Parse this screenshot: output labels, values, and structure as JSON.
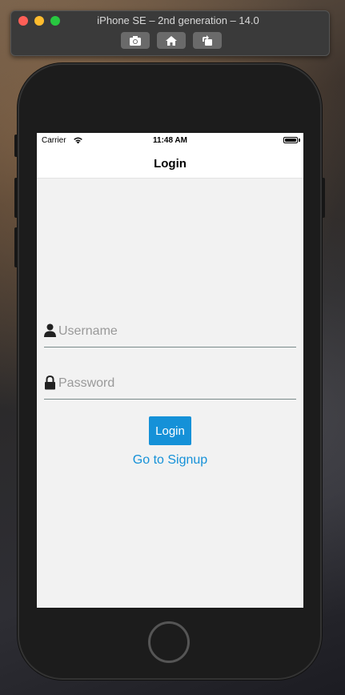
{
  "simulator": {
    "title": "iPhone SE – 2nd generation – 14.0",
    "buttons": [
      "screenshot-icon",
      "home-icon",
      "rotate-icon"
    ]
  },
  "status_bar": {
    "carrier": "Carrier",
    "time": "11:48 AM"
  },
  "nav": {
    "title": "Login"
  },
  "form": {
    "username_placeholder": "Username",
    "password_placeholder": "Password",
    "login_label": "Login",
    "signup_label": "Go to Signup"
  },
  "colors": {
    "accent": "#1591d8",
    "screen_bg": "#f2f2f2"
  }
}
